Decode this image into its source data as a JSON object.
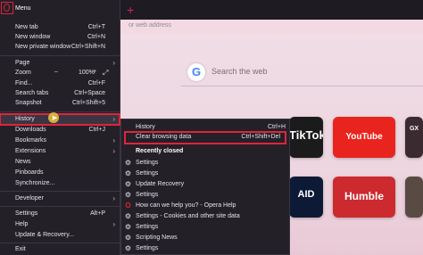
{
  "browser": {
    "address_placeholder": "or web address",
    "search_placeholder": "Search the web",
    "new_tab_symbol": "+",
    "speed_dial": {
      "tiktok": "TikTok",
      "youtube": "YouTube",
      "gx": "GX",
      "game": "AID",
      "humble": "Humble"
    }
  },
  "menu": {
    "title": "Menu",
    "items": [
      {
        "label": "New tab",
        "shortcut": "Ctrl+T"
      },
      {
        "label": "New window",
        "shortcut": "Ctrl+N"
      },
      {
        "label": "New private window",
        "shortcut": "Ctrl+Shift+N"
      },
      {
        "label": "Page",
        "shortcut": ""
      },
      {
        "label": "Zoom",
        "shortcut": ""
      },
      {
        "label": "Find...",
        "shortcut": "Ctrl+F"
      },
      {
        "label": "Search tabs",
        "shortcut": "Ctrl+Space"
      },
      {
        "label": "Snapshot",
        "shortcut": "Ctrl+Shift+5"
      },
      {
        "label": "History",
        "shortcut": ""
      },
      {
        "label": "Downloads",
        "shortcut": "Ctrl+J"
      },
      {
        "label": "Bookmarks",
        "shortcut": ""
      },
      {
        "label": "Extensions",
        "shortcut": ""
      },
      {
        "label": "News",
        "shortcut": ""
      },
      {
        "label": "Pinboards",
        "shortcut": ""
      },
      {
        "label": "Synchronize...",
        "shortcut": ""
      },
      {
        "label": "Developer",
        "shortcut": ""
      },
      {
        "label": "Settings",
        "shortcut": "Alt+P"
      },
      {
        "label": "Help",
        "shortcut": ""
      },
      {
        "label": "Update & Recovery...",
        "shortcut": ""
      },
      {
        "label": "Exit",
        "shortcut": ""
      }
    ],
    "zoom": {
      "minus": "–",
      "value": "100%",
      "plus": "+",
      "fullscreen": "⤢"
    },
    "arrow": "›"
  },
  "history_submenu": {
    "history": {
      "label": "History",
      "shortcut": "Ctrl+H"
    },
    "clear": {
      "label": "Clear browsing data",
      "shortcut": "Ctrl+Shift+Del"
    },
    "recently_closed_header": "Recently closed",
    "recent": [
      {
        "label": "Settings",
        "icon": "gear-icon"
      },
      {
        "label": "Settings",
        "icon": "gear-icon"
      },
      {
        "label": "Update  Recovery",
        "icon": "gear-icon"
      },
      {
        "label": "Settings",
        "icon": "gear-icon"
      },
      {
        "label": "How can we help you? - Opera Help",
        "icon": "opera-icon"
      },
      {
        "label": "Settings - Cookies and other site data",
        "icon": "gear-icon"
      },
      {
        "label": "Settings",
        "icon": "gear-icon"
      },
      {
        "label": "Scripting News",
        "icon": "gear-icon"
      },
      {
        "label": "Settings",
        "icon": "gear-icon"
      }
    ]
  },
  "colors": {
    "accent": "#e0243a",
    "menu_bg": "#242028",
    "page_bg": "#f0dde6"
  }
}
